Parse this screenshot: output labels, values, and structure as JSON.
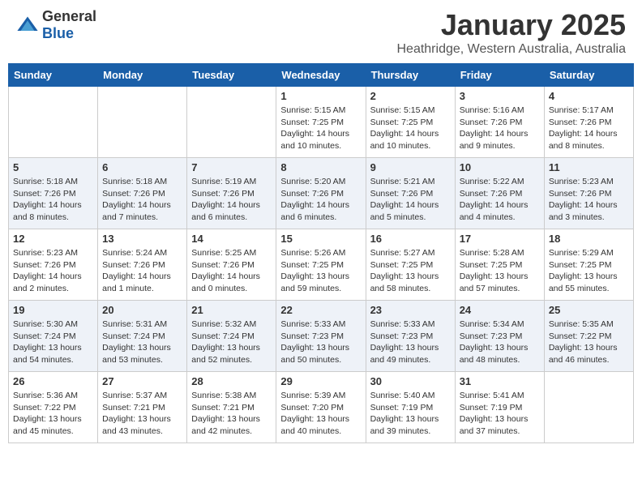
{
  "header": {
    "logo_general": "General",
    "logo_blue": "Blue",
    "month_title": "January 2025",
    "subtitle": "Heathridge, Western Australia, Australia"
  },
  "weekdays": [
    "Sunday",
    "Monday",
    "Tuesday",
    "Wednesday",
    "Thursday",
    "Friday",
    "Saturday"
  ],
  "weeks": [
    [
      {
        "day": "",
        "info": ""
      },
      {
        "day": "",
        "info": ""
      },
      {
        "day": "",
        "info": ""
      },
      {
        "day": "1",
        "info": "Sunrise: 5:15 AM\nSunset: 7:25 PM\nDaylight: 14 hours\nand 10 minutes."
      },
      {
        "day": "2",
        "info": "Sunrise: 5:15 AM\nSunset: 7:25 PM\nDaylight: 14 hours\nand 10 minutes."
      },
      {
        "day": "3",
        "info": "Sunrise: 5:16 AM\nSunset: 7:26 PM\nDaylight: 14 hours\nand 9 minutes."
      },
      {
        "day": "4",
        "info": "Sunrise: 5:17 AM\nSunset: 7:26 PM\nDaylight: 14 hours\nand 8 minutes."
      }
    ],
    [
      {
        "day": "5",
        "info": "Sunrise: 5:18 AM\nSunset: 7:26 PM\nDaylight: 14 hours\nand 8 minutes."
      },
      {
        "day": "6",
        "info": "Sunrise: 5:18 AM\nSunset: 7:26 PM\nDaylight: 14 hours\nand 7 minutes."
      },
      {
        "day": "7",
        "info": "Sunrise: 5:19 AM\nSunset: 7:26 PM\nDaylight: 14 hours\nand 6 minutes."
      },
      {
        "day": "8",
        "info": "Sunrise: 5:20 AM\nSunset: 7:26 PM\nDaylight: 14 hours\nand 6 minutes."
      },
      {
        "day": "9",
        "info": "Sunrise: 5:21 AM\nSunset: 7:26 PM\nDaylight: 14 hours\nand 5 minutes."
      },
      {
        "day": "10",
        "info": "Sunrise: 5:22 AM\nSunset: 7:26 PM\nDaylight: 14 hours\nand 4 minutes."
      },
      {
        "day": "11",
        "info": "Sunrise: 5:23 AM\nSunset: 7:26 PM\nDaylight: 14 hours\nand 3 minutes."
      }
    ],
    [
      {
        "day": "12",
        "info": "Sunrise: 5:23 AM\nSunset: 7:26 PM\nDaylight: 14 hours\nand 2 minutes."
      },
      {
        "day": "13",
        "info": "Sunrise: 5:24 AM\nSunset: 7:26 PM\nDaylight: 14 hours\nand 1 minute."
      },
      {
        "day": "14",
        "info": "Sunrise: 5:25 AM\nSunset: 7:26 PM\nDaylight: 14 hours\nand 0 minutes."
      },
      {
        "day": "15",
        "info": "Sunrise: 5:26 AM\nSunset: 7:25 PM\nDaylight: 13 hours\nand 59 minutes."
      },
      {
        "day": "16",
        "info": "Sunrise: 5:27 AM\nSunset: 7:25 PM\nDaylight: 13 hours\nand 58 minutes."
      },
      {
        "day": "17",
        "info": "Sunrise: 5:28 AM\nSunset: 7:25 PM\nDaylight: 13 hours\nand 57 minutes."
      },
      {
        "day": "18",
        "info": "Sunrise: 5:29 AM\nSunset: 7:25 PM\nDaylight: 13 hours\nand 55 minutes."
      }
    ],
    [
      {
        "day": "19",
        "info": "Sunrise: 5:30 AM\nSunset: 7:24 PM\nDaylight: 13 hours\nand 54 minutes."
      },
      {
        "day": "20",
        "info": "Sunrise: 5:31 AM\nSunset: 7:24 PM\nDaylight: 13 hours\nand 53 minutes."
      },
      {
        "day": "21",
        "info": "Sunrise: 5:32 AM\nSunset: 7:24 PM\nDaylight: 13 hours\nand 52 minutes."
      },
      {
        "day": "22",
        "info": "Sunrise: 5:33 AM\nSunset: 7:23 PM\nDaylight: 13 hours\nand 50 minutes."
      },
      {
        "day": "23",
        "info": "Sunrise: 5:33 AM\nSunset: 7:23 PM\nDaylight: 13 hours\nand 49 minutes."
      },
      {
        "day": "24",
        "info": "Sunrise: 5:34 AM\nSunset: 7:23 PM\nDaylight: 13 hours\nand 48 minutes."
      },
      {
        "day": "25",
        "info": "Sunrise: 5:35 AM\nSunset: 7:22 PM\nDaylight: 13 hours\nand 46 minutes."
      }
    ],
    [
      {
        "day": "26",
        "info": "Sunrise: 5:36 AM\nSunset: 7:22 PM\nDaylight: 13 hours\nand 45 minutes."
      },
      {
        "day": "27",
        "info": "Sunrise: 5:37 AM\nSunset: 7:21 PM\nDaylight: 13 hours\nand 43 minutes."
      },
      {
        "day": "28",
        "info": "Sunrise: 5:38 AM\nSunset: 7:21 PM\nDaylight: 13 hours\nand 42 minutes."
      },
      {
        "day": "29",
        "info": "Sunrise: 5:39 AM\nSunset: 7:20 PM\nDaylight: 13 hours\nand 40 minutes."
      },
      {
        "day": "30",
        "info": "Sunrise: 5:40 AM\nSunset: 7:19 PM\nDaylight: 13 hours\nand 39 minutes."
      },
      {
        "day": "31",
        "info": "Sunrise: 5:41 AM\nSunset: 7:19 PM\nDaylight: 13 hours\nand 37 minutes."
      },
      {
        "day": "",
        "info": ""
      }
    ]
  ]
}
